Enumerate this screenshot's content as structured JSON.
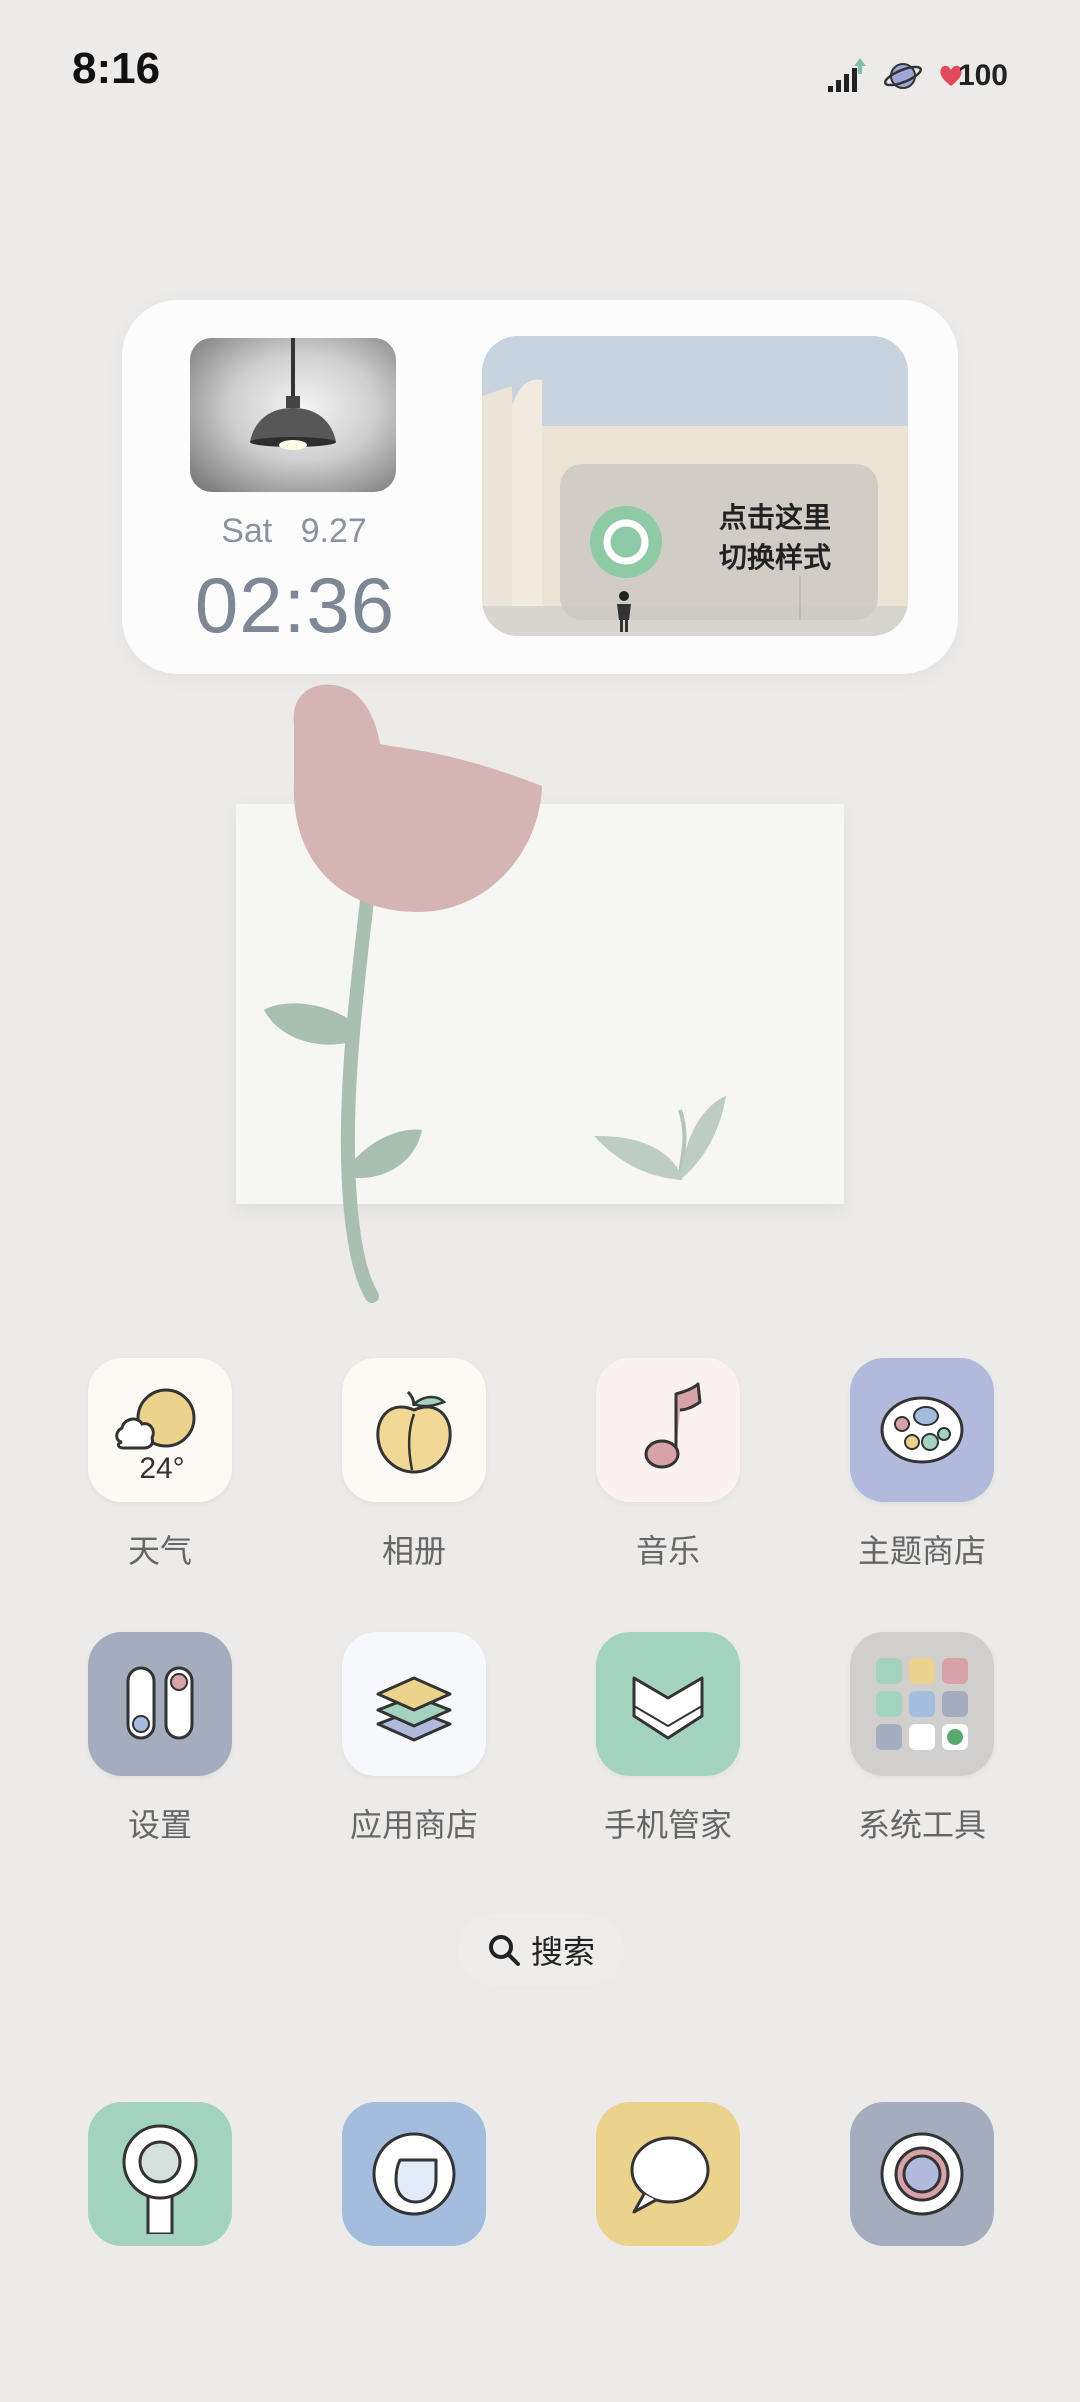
{
  "status_bar": {
    "time": "8:16",
    "battery": "100",
    "icons": [
      "signal-icon",
      "planet-icon",
      "battery-heart-icon"
    ]
  },
  "widget": {
    "day": "Sat",
    "date": "9.27",
    "clock": "02:36",
    "switch_text": "点击这里\n切换样式",
    "lamp_image": "pendant-lamp",
    "photo_image": "building-scene"
  },
  "apps": [
    {
      "label": "天气",
      "icon": "weather-icon",
      "temp": "24°",
      "bg": "#fbfaf5"
    },
    {
      "label": "相册",
      "icon": "peach-icon",
      "bg": "#fbfaf5"
    },
    {
      "label": "音乐",
      "icon": "music-note-icon",
      "bg": "#fbf1f1"
    },
    {
      "label": "主题商店",
      "icon": "palette-icon",
      "bg": "#b1b9dd"
    },
    {
      "label": "设置",
      "icon": "toggle-icon",
      "bg": "#a3adbd"
    },
    {
      "label": "应用商店",
      "icon": "layers-icon",
      "bg": "#f7f8fb"
    },
    {
      "label": "手机管家",
      "icon": "shield-icon",
      "bg": "#a3d3bf"
    },
    {
      "label": "系统工具",
      "icon": "folder-grid-icon",
      "bg": "#d0cfcd"
    }
  ],
  "search": {
    "label": "搜索"
  },
  "dock": [
    {
      "icon": "phone-icon",
      "bg": "#a3d3bf"
    },
    {
      "icon": "browser-icon",
      "bg": "#a4bddf"
    },
    {
      "icon": "message-icon",
      "bg": "#ebd28d"
    },
    {
      "icon": "camera-icon",
      "bg": "#a3adbd"
    }
  ]
}
